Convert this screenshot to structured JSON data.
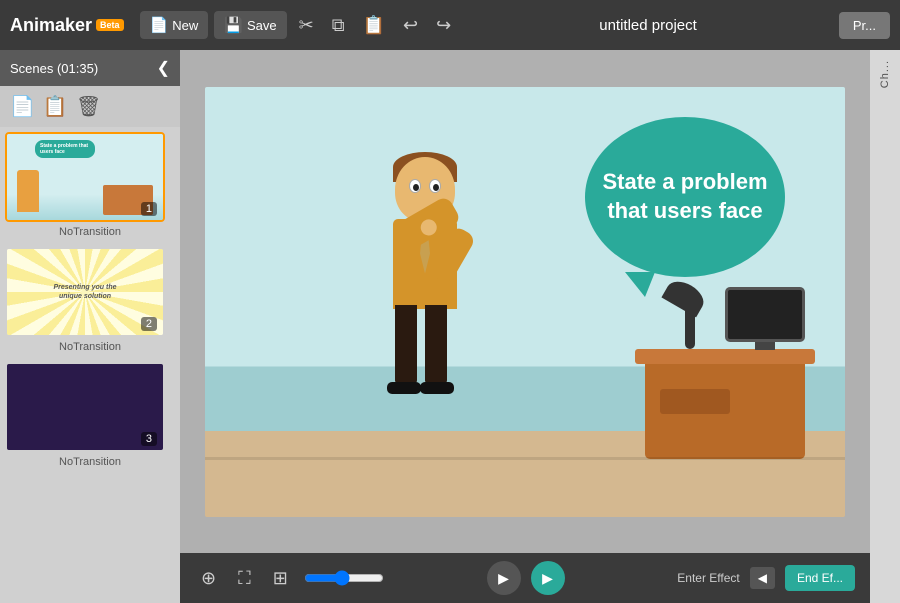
{
  "app": {
    "name": "Animaker",
    "beta": "Beta"
  },
  "toolbar": {
    "new_label": "New",
    "save_label": "Save",
    "undo_icon": "↩",
    "redo_icon": "↪",
    "cut_icon": "✂",
    "copy_icon": "⧉",
    "paste_icon": "📋",
    "preview_label": "Pr..."
  },
  "project": {
    "title": "untitled project"
  },
  "sidebar": {
    "header": "Scenes (01:35)",
    "collapse_icon": "❮"
  },
  "scenes": [
    {
      "id": 1,
      "active": true,
      "transition": "NoTransition",
      "speech_text": "State a problem that users face"
    },
    {
      "id": 2,
      "active": false,
      "transition": "NoTransition",
      "text": "Presenting you the unique solution"
    },
    {
      "id": 3,
      "active": false,
      "transition": "NoTransition"
    }
  ],
  "canvas": {
    "speech_bubble_text": "State a problem that users face"
  },
  "bottom_bar": {
    "enter_effect_label": "Enter Effect",
    "end_effect_label": "End Ef..."
  },
  "right_panel": {
    "label": "Ch..."
  }
}
